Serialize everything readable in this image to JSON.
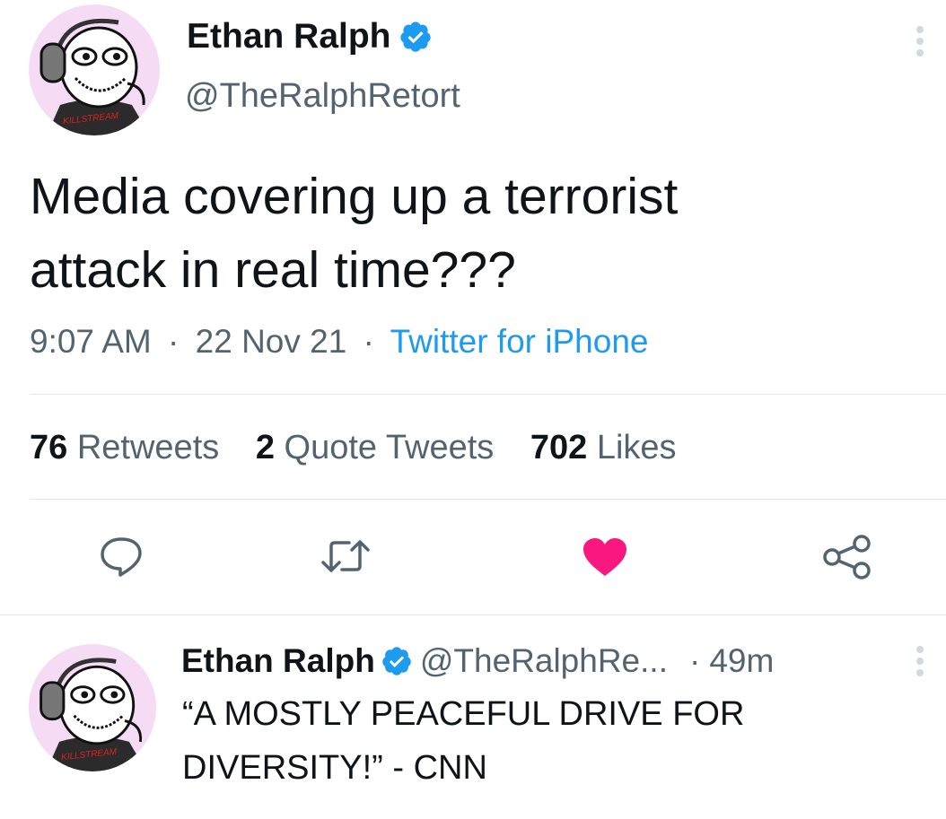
{
  "main_tweet": {
    "author_name": "Ethan Ralph",
    "author_handle": "@TheRalphRetort",
    "avatar_text": "KILLSTREAM",
    "text_line1": "Media covering up a terrorist",
    "text_line2": "attack in real time???",
    "time": "9:07 AM",
    "date": "22 Nov 21",
    "separator": "·",
    "source": "Twitter for iPhone",
    "retweets_count": "76",
    "retweets_label": "Retweets",
    "quotes_count": "2",
    "quotes_label": "Quote Tweets",
    "likes_count": "702",
    "likes_label": "Likes"
  },
  "reply_tweet": {
    "author_name": "Ethan Ralph",
    "author_handle": "@TheRalphRe...",
    "separator": "·",
    "age": "49m",
    "avatar_text": "KILLSTREAM",
    "text_line1": "“A MOSTLY PEACEFUL DRIVE FOR",
    "text_line2": "DIVERSITY!” - CNN"
  },
  "icons": {
    "verified": "verified-badge-icon",
    "reply": "reply-icon",
    "retweet": "retweet-icon",
    "like": "heart-icon",
    "share": "share-icon",
    "more": "more-vertical-icon"
  },
  "colors": {
    "verified": "#1d9bf0",
    "like_active": "#f91880",
    "secondary_text": "#536471",
    "link": "#1d9bf0"
  }
}
